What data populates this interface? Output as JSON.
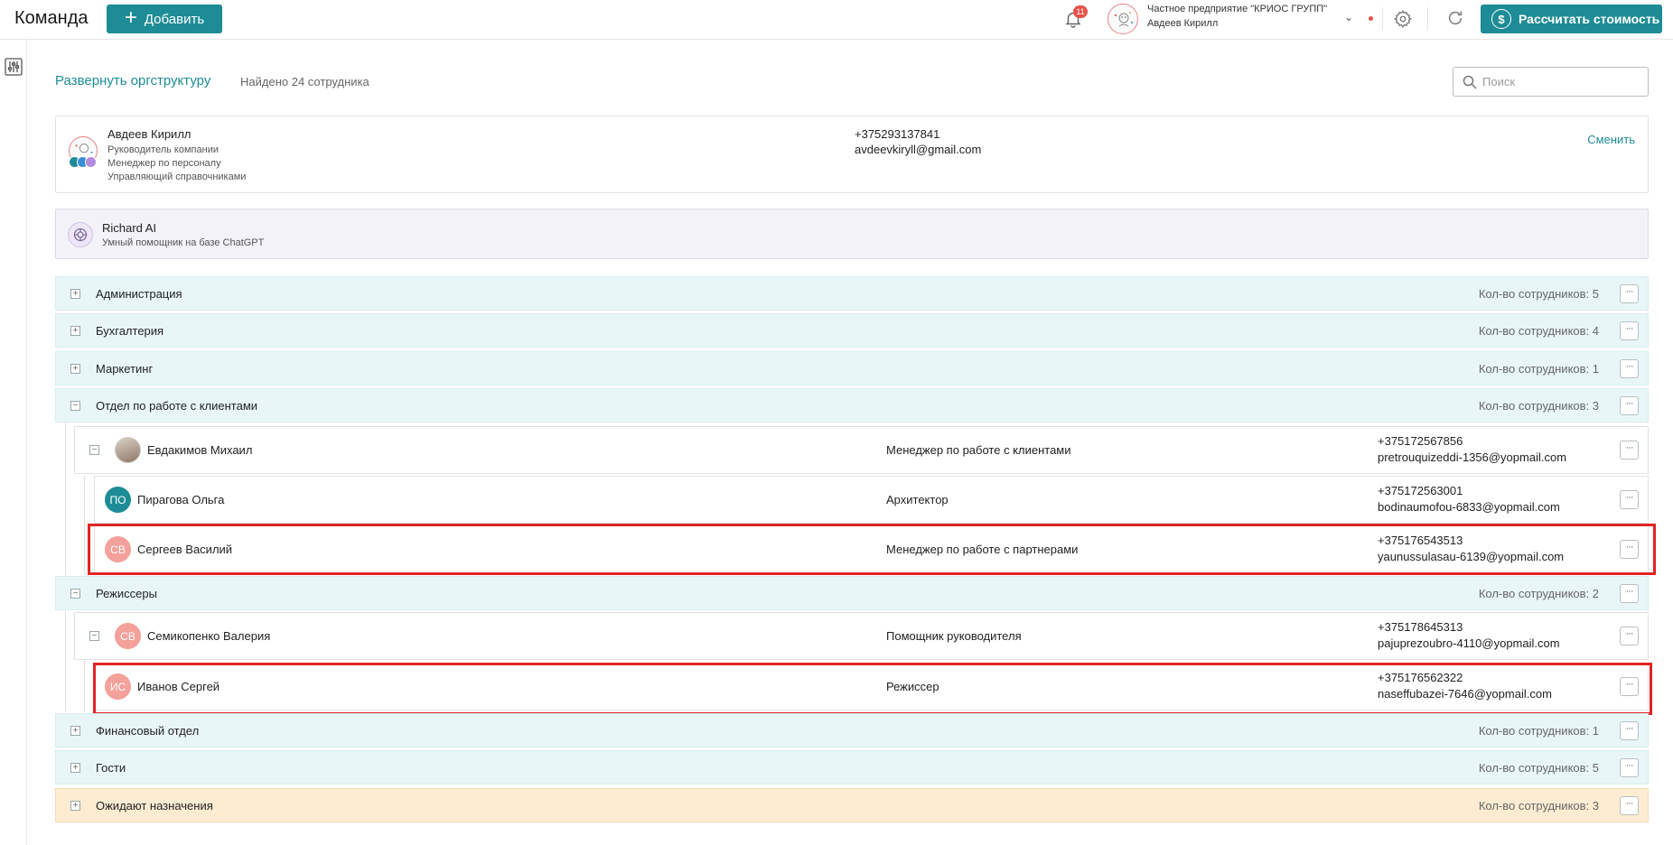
{
  "header": {
    "title": "Команда",
    "add_label": "Добавить",
    "notifications_count": "11",
    "company_name": "Частное предприятие \"КРИОС ГРУПП\"",
    "user_name": "Авдеев Кирилл",
    "calc_label": "Рассчитать стоимость"
  },
  "toolbar": {
    "expand_label": "Развернуть оргструктуру",
    "found_text": "Найдено 24 сотрудника",
    "search_placeholder": "Поиск"
  },
  "profile": {
    "name": "Авдеев Кирилл",
    "roles": [
      "Руководитель компании",
      "Менеджер по персоналу",
      "Управляющий справочниками"
    ],
    "phone": "+375293137841",
    "email": "avdeevkiryll@gmail.com",
    "change_label": "Сменить"
  },
  "assistant": {
    "name": "Richard AI",
    "description": "Умный помощник на базе ChatGPT"
  },
  "departments": [
    {
      "name": "Администрация",
      "count": "Кол-во сотрудников: 5",
      "toggle": "+"
    },
    {
      "name": "Бухгалтерия",
      "count": "Кол-во сотрудников: 4",
      "toggle": "+"
    },
    {
      "name": "Маркетинг",
      "count": "Кол-во сотрудников: 1",
      "toggle": "+"
    },
    {
      "name": "Отдел по работе с клиентами",
      "count": "Кол-во сотрудников: 3",
      "toggle": "−"
    },
    {
      "name": "Режиссеры",
      "count": "Кол-во сотрудников: 2",
      "toggle": "−"
    },
    {
      "name": "Финансовый отдел",
      "count": "Кол-во сотрудников: 1",
      "toggle": "+"
    },
    {
      "name": "Гости",
      "count": "Кол-во сотрудников: 5",
      "toggle": "+"
    },
    {
      "name": "Ожидают назначения",
      "count": "Кол-во сотрудников: 3",
      "toggle": "+"
    }
  ],
  "employees": [
    {
      "name": "Евдакимов Михаил",
      "initials": "",
      "role": "Менеджер по работе с клиентами",
      "phone": "+375172567856",
      "email": "pretrouquizeddi-1356@yopmail.com",
      "avatar_color": "#b9a99a"
    },
    {
      "name": "Пирагова Ольга",
      "initials": "ПО",
      "role": "Архитектор",
      "phone": "+375172563001",
      "email": "bodinaumofou-6833@yopmail.com",
      "avatar_color": "#1d8c96"
    },
    {
      "name": "Сергеев Василий",
      "initials": "СВ",
      "role": "Менеджер по работе с партнерами",
      "phone": "+375176543513",
      "email": "yaunussulasau-6139@yopmail.com",
      "avatar_color": "#f4a09b"
    },
    {
      "name": "Семикопенко Валерия",
      "initials": "СВ",
      "role": "Помощник руководителя",
      "phone": "+375178645313",
      "email": "pajuprezoubro-4110@yopmail.com",
      "avatar_color": "#f4a09b"
    },
    {
      "name": "Иванов Сергей",
      "initials": "ИС",
      "role": "Режиссер",
      "phone": "+375176562322",
      "email": "naseffubazei-7646@yopmail.com",
      "avatar_color": "#f4a09b"
    }
  ],
  "colors": {
    "accent": "#1d8c96",
    "department_bg": "#e8f6f8",
    "pending_bg": "#fdecd2",
    "highlight": "#e02424",
    "badge": "#e5534b"
  }
}
